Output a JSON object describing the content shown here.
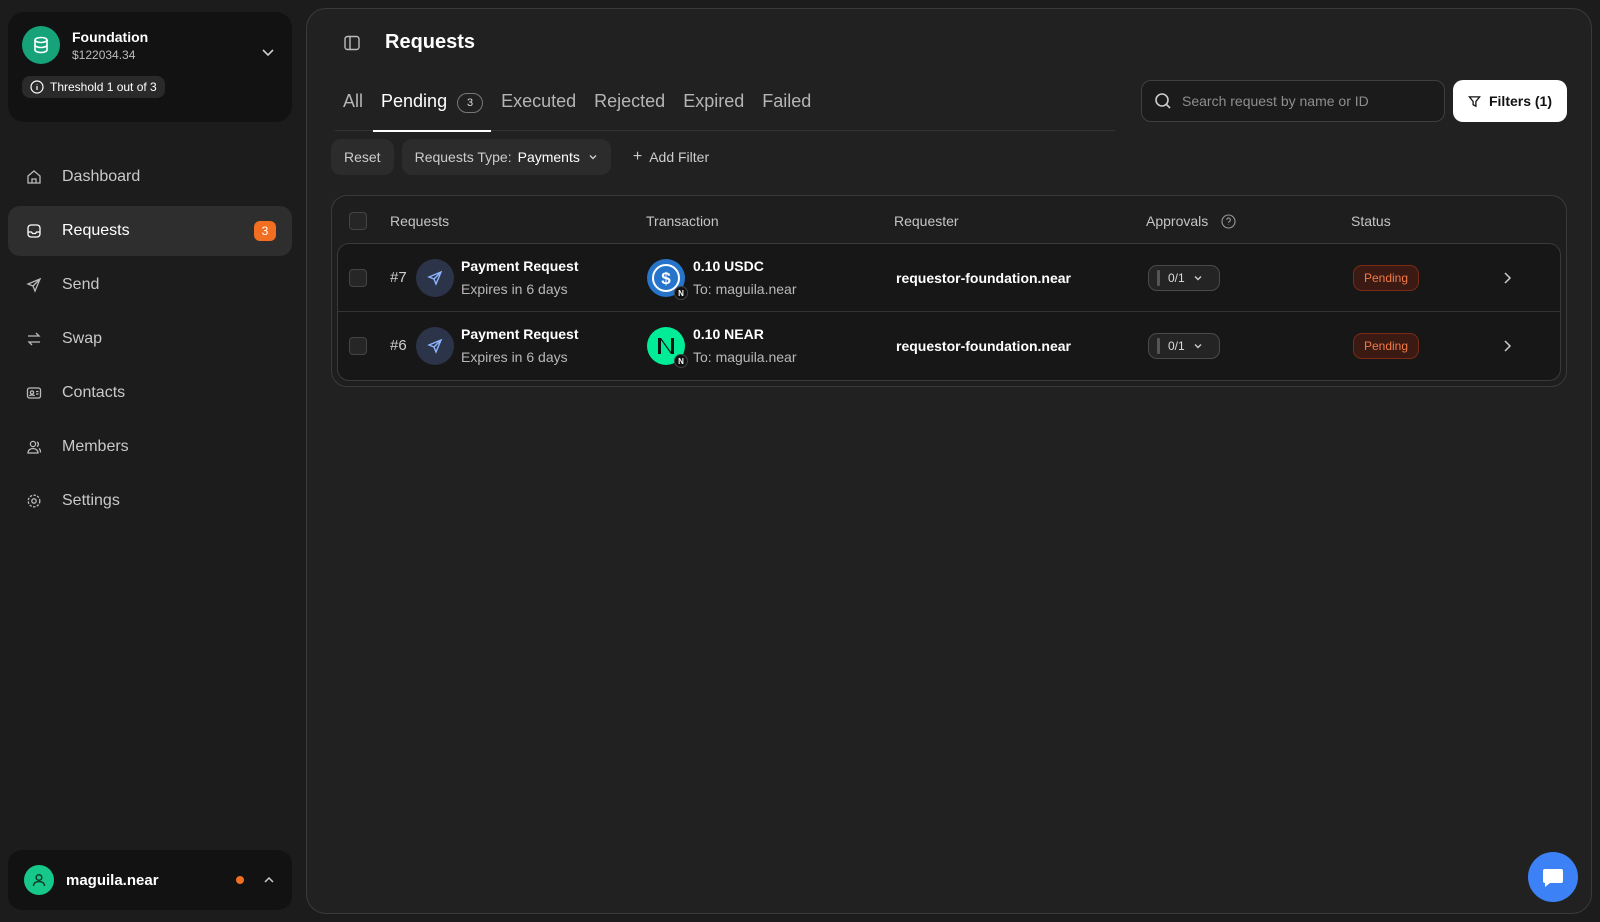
{
  "org": {
    "name": "Foundation",
    "balance": "$122034.34",
    "threshold": "Threshold 1 out of 3"
  },
  "nav": {
    "items": [
      {
        "label": "Dashboard",
        "icon": "home-icon"
      },
      {
        "label": "Requests",
        "icon": "inbox-icon",
        "badge": "3",
        "active": true
      },
      {
        "label": "Send",
        "icon": "send-icon"
      },
      {
        "label": "Swap",
        "icon": "swap-icon"
      },
      {
        "label": "Contacts",
        "icon": "contacts-icon"
      },
      {
        "label": "Members",
        "icon": "members-icon"
      },
      {
        "label": "Settings",
        "icon": "gear-icon"
      }
    ]
  },
  "user": {
    "name": "maguila.near"
  },
  "header": {
    "title": "Requests"
  },
  "tabs": [
    {
      "label": "All"
    },
    {
      "label": "Pending",
      "count": "3",
      "active": true
    },
    {
      "label": "Executed"
    },
    {
      "label": "Rejected"
    },
    {
      "label": "Expired"
    },
    {
      "label": "Failed"
    }
  ],
  "search": {
    "placeholder": "Search request by name or ID",
    "value": ""
  },
  "filters_button": "Filters (1)",
  "filter_bar": {
    "reset": "Reset",
    "type_label": "Requests Type:",
    "type_value": "Payments",
    "add_filter": "Add Filter"
  },
  "table": {
    "columns": [
      "Requests",
      "Transaction",
      "Requester",
      "Approvals",
      "Status"
    ],
    "rows": [
      {
        "id": "#7",
        "title": "Payment Request",
        "expires": "Expires in 6 days",
        "amount": "0.10 USDC",
        "to": "To: maguila.near",
        "token": "usdc-icon",
        "requester": "requestor-foundation.near",
        "approvals": "0/1",
        "status": "Pending"
      },
      {
        "id": "#6",
        "title": "Payment Request",
        "expires": "Expires in 6 days",
        "amount": "0.10 NEAR",
        "to": "To: maguila.near",
        "token": "near-icon",
        "requester": "requestor-foundation.near",
        "approvals": "0/1",
        "status": "Pending"
      }
    ]
  },
  "colors": {
    "accent": "#f26f21",
    "brand_green": "#16a37a",
    "chat_blue": "#3c82f6",
    "pending_text": "#f37a48"
  },
  "network_badge": "N"
}
